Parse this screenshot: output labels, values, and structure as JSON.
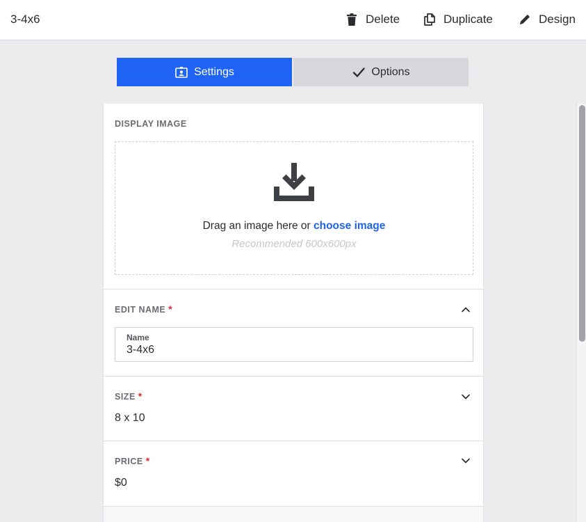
{
  "header": {
    "title": "3-4x6",
    "actions": {
      "delete": "Delete",
      "duplicate": "Duplicate",
      "design": "Design"
    }
  },
  "tabs": [
    {
      "label": "Settings",
      "icon": "id-badge-icon",
      "active": true
    },
    {
      "label": "Options",
      "icon": "checkmark-icon",
      "active": false
    }
  ],
  "display_image": {
    "label": "DISPLAY IMAGE",
    "drop_text": "Drag an image here or ",
    "choose_link": "choose image",
    "hint": "Recommended 600x600px",
    "icon": "download-icon"
  },
  "edit_name": {
    "label": "EDIT NAME",
    "required_mark": "*",
    "field_label": "Name",
    "value": "3-4x6"
  },
  "size": {
    "label": "SIZE",
    "required_mark": "*",
    "value": "8 x 10"
  },
  "price": {
    "label": "PRICE",
    "required_mark": "*",
    "value": "$0"
  },
  "colors": {
    "accent": "#1f63f5",
    "required": "#e0282e",
    "background": "#ececee"
  }
}
